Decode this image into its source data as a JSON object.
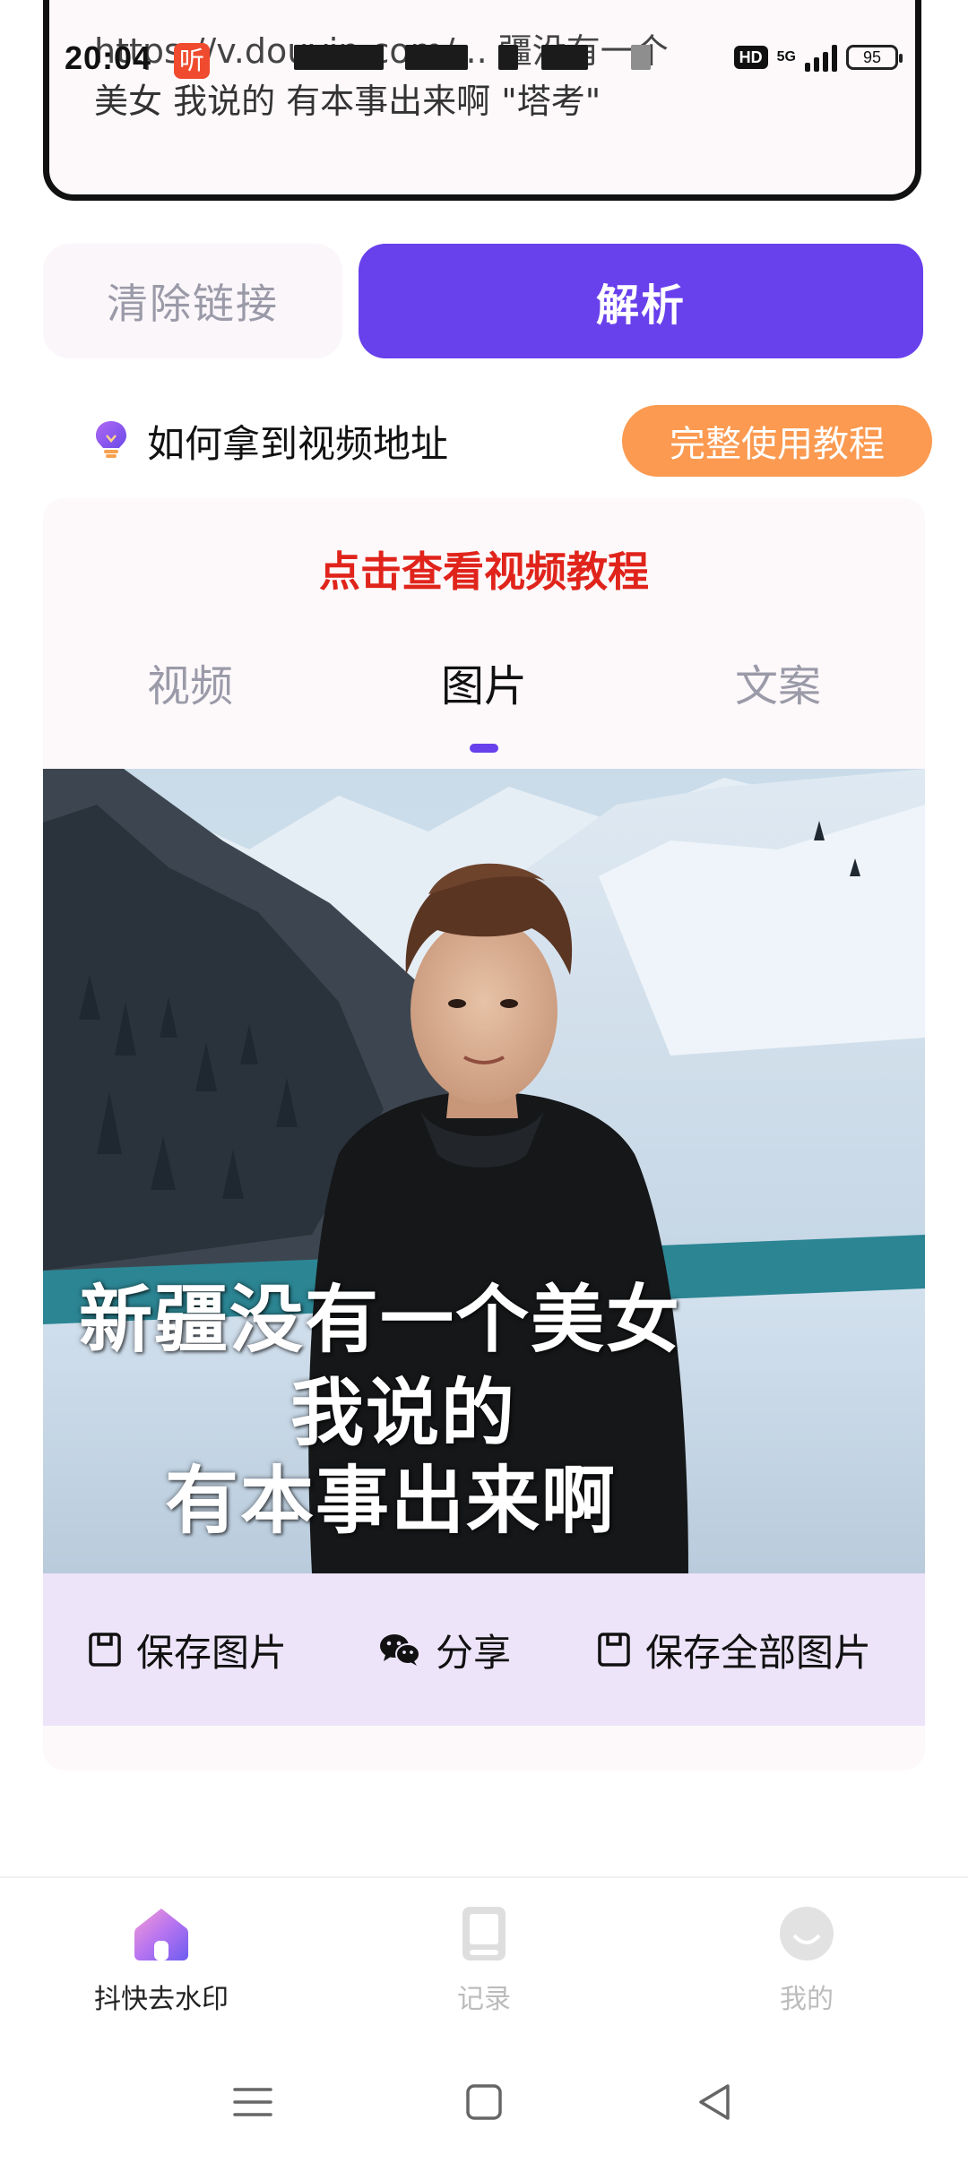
{
  "status_bar": {
    "time": "20:04",
    "notification_badge": "听",
    "hd_label": "HD",
    "network": "5G",
    "battery": "95"
  },
  "link_input": {
    "line1": "https://v.douyin.com/...    疆没有一个",
    "line2": "美女 我说的 有本事出来啊 \"塔考\""
  },
  "buttons": {
    "clear_label": "清除链接",
    "parse_label": "解析"
  },
  "tip": {
    "text": "如何拿到视频地址",
    "tutorial_button": "完整使用教程"
  },
  "result": {
    "video_tutorial_link": "点击查看视频教程",
    "tabs": [
      {
        "label": "视频",
        "active": false
      },
      {
        "label": "图片",
        "active": true
      },
      {
        "label": "文案",
        "active": false
      }
    ],
    "image_caption": {
      "line1": "新疆没有一个美女",
      "line2": "我说的",
      "line3": "有本事出来啊"
    },
    "actions": {
      "save_image": "保存图片",
      "share": "分享",
      "save_all": "保存全部图片"
    }
  },
  "bottom_nav": {
    "items": [
      {
        "label": "抖快去水印",
        "icon": "home-icon",
        "active": true
      },
      {
        "label": "记录",
        "icon": "book-icon",
        "active": false
      },
      {
        "label": "我的",
        "icon": "profile-icon",
        "active": false
      }
    ]
  },
  "colors": {
    "accent": "#6840ec",
    "tutorial_orange": "#fb9a50",
    "link_red": "#e0241b",
    "action_bar_bg": "#ede4f9"
  }
}
